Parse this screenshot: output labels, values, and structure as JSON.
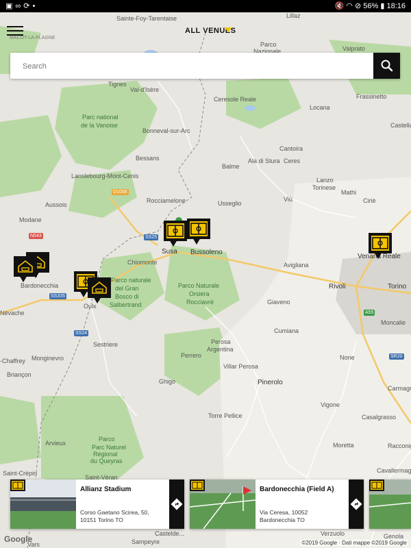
{
  "status_bar": {
    "left_icons": [
      "photo-icon",
      "infinity-icon",
      "sync-icon",
      "dot-icon"
    ],
    "battery": "56%",
    "time": "18:16"
  },
  "header": {
    "title": "ALL VENUES"
  },
  "search": {
    "placeholder": "Search"
  },
  "map": {
    "labels": [
      {
        "text": "Sainte-Foy-Tarentaise",
        "cls": ""
      },
      {
        "text": "MACOT-LA-PLAGNE",
        "cls": "small"
      },
      {
        "text": "Lillaz",
        "cls": ""
      },
      {
        "text": "Parco",
        "cls": ""
      },
      {
        "text": "Nazionale",
        "cls": ""
      },
      {
        "text": "Valprato",
        "cls": ""
      },
      {
        "text": "Tignes",
        "cls": ""
      },
      {
        "text": "Val-d'Isère",
        "cls": ""
      },
      {
        "text": "Ceresole Reale",
        "cls": ""
      },
      {
        "text": "Frassinetto",
        "cls": ""
      },
      {
        "text": "Locana",
        "cls": ""
      },
      {
        "text": "Parc national",
        "cls": "green"
      },
      {
        "text": "de la Vanoise",
        "cls": "green"
      },
      {
        "text": "Castella",
        "cls": ""
      },
      {
        "text": "Bonneval-sur-Arc",
        "cls": ""
      },
      {
        "text": "Cantoira",
        "cls": ""
      },
      {
        "text": "Bessans",
        "cls": ""
      },
      {
        "text": "Ala di Stura",
        "cls": ""
      },
      {
        "text": "Ceres",
        "cls": ""
      },
      {
        "text": "Balme",
        "cls": ""
      },
      {
        "text": "Lanslebourg-Mont-Cenis",
        "cls": ""
      },
      {
        "text": "Lanzo",
        "cls": ""
      },
      {
        "text": "Torinese",
        "cls": ""
      },
      {
        "text": "Mathi",
        "cls": ""
      },
      {
        "text": "Viù",
        "cls": ""
      },
      {
        "text": "Ciriè",
        "cls": ""
      },
      {
        "text": "Aussois",
        "cls": ""
      },
      {
        "text": "Rocciamelone",
        "cls": ""
      },
      {
        "text": "Usseglio",
        "cls": ""
      },
      {
        "text": "Modane",
        "cls": ""
      },
      {
        "text": "Susa",
        "cls": "dark"
      },
      {
        "text": "Bussoleno",
        "cls": "dark"
      },
      {
        "text": "Venaria Reale",
        "cls": "dark"
      },
      {
        "text": "Bardonecchia",
        "cls": ""
      },
      {
        "text": "Chiomonte",
        "cls": ""
      },
      {
        "text": "Parco naturale",
        "cls": "green"
      },
      {
        "text": "del Gran",
        "cls": "green"
      },
      {
        "text": "Bosco di",
        "cls": "green"
      },
      {
        "text": "Salbertrand",
        "cls": "green"
      },
      {
        "text": "Oulx",
        "cls": ""
      },
      {
        "text": "Parco Naturale",
        "cls": "green"
      },
      {
        "text": "Orsiera",
        "cls": "green"
      },
      {
        "text": "Rocciavrè",
        "cls": "green"
      },
      {
        "text": "Avigliana",
        "cls": ""
      },
      {
        "text": "Rivoli",
        "cls": "dark"
      },
      {
        "text": "Torino",
        "cls": "dark"
      },
      {
        "text": "Giaveno",
        "cls": ""
      },
      {
        "text": "Moncalie",
        "cls": ""
      },
      {
        "text": "Névache",
        "cls": ""
      },
      {
        "text": "Cumiana",
        "cls": ""
      },
      {
        "text": "Sestriere",
        "cls": ""
      },
      {
        "text": "Perosa",
        "cls": ""
      },
      {
        "text": "Argentina",
        "cls": ""
      },
      {
        "text": "Perrero",
        "cls": ""
      },
      {
        "text": "None",
        "cls": ""
      },
      {
        "text": "-Chaffrey",
        "cls": ""
      },
      {
        "text": "Monginevro",
        "cls": ""
      },
      {
        "text": "Villar Perosa",
        "cls": ""
      },
      {
        "text": "Briançon",
        "cls": ""
      },
      {
        "text": "Ghigo",
        "cls": ""
      },
      {
        "text": "Pinerolo",
        "cls": "dark"
      },
      {
        "text": "Vigone",
        "cls": ""
      },
      {
        "text": "Carmagno",
        "cls": ""
      },
      {
        "text": "Torre Pellice",
        "cls": ""
      },
      {
        "text": "Casalgrasso",
        "cls": ""
      },
      {
        "text": "Arvieux",
        "cls": ""
      },
      {
        "text": "Parco",
        "cls": "green"
      },
      {
        "text": "Parc Naturel",
        "cls": "green"
      },
      {
        "text": "Régional",
        "cls": "green"
      },
      {
        "text": "du Queyras",
        "cls": "green"
      },
      {
        "text": "Moretta",
        "cls": ""
      },
      {
        "text": "Racconigi",
        "cls": ""
      },
      {
        "text": "Cavallermag",
        "cls": ""
      },
      {
        "text": "Saint-Véran",
        "cls": ""
      },
      {
        "text": "Saint-Crépin",
        "cls": ""
      },
      {
        "text": "Castelde...",
        "cls": ""
      },
      {
        "text": "Verzuolo",
        "cls": ""
      },
      {
        "text": "Sampeyre",
        "cls": ""
      },
      {
        "text": "Vars",
        "cls": ""
      },
      {
        "text": "Genola",
        "cls": ""
      }
    ],
    "route_badges": [
      {
        "text": "D1006",
        "color": "#e8a93a"
      },
      {
        "text": "N543",
        "color": "#d9534f"
      },
      {
        "text": "SS25",
        "color": "#3c6fb0"
      },
      {
        "text": "SS335",
        "color": "#3c6fb0"
      },
      {
        "text": "SS24",
        "color": "#3c6fb0"
      },
      {
        "text": "A55",
        "color": "#3c9a4a"
      },
      {
        "text": "SR20",
        "color": "#3c6fb0"
      }
    ],
    "markers": [
      {
        "name": "field-marker-susa",
        "kind": "field"
      },
      {
        "name": "field-marker-bussoleno",
        "kind": "field"
      },
      {
        "name": "field-marker-venaria",
        "kind": "field"
      },
      {
        "name": "lodging-marker-bardonecchia-1",
        "kind": "lodging"
      },
      {
        "name": "lodging-marker-bardonecchia-2",
        "kind": "lodging"
      },
      {
        "name": "field-marker-oulx",
        "kind": "field"
      },
      {
        "name": "lodging-marker-oulx",
        "kind": "lodging"
      }
    ],
    "colors": {
      "land": "#e8e6e0",
      "forest": "#b9d9a4",
      "city": "#d8d6d0",
      "road_major": "#f3c96a",
      "road": "#ffffff",
      "border": "#8a8a8a",
      "accent": "#f5c400"
    }
  },
  "cards": [
    {
      "title": "Allianz Stadium",
      "address_line1": "Corso Gaetano Scirea, 50,",
      "address_line2": "10151 Torino TO"
    },
    {
      "title": "Bardonecchia (Field A)",
      "address_line1": "Via Ceresa, 10052",
      "address_line2": "Bardonecchia TO"
    }
  ],
  "footer": {
    "logo": "Google",
    "copyright": "©2019 Google · Dati mappe ©2019 Google"
  }
}
